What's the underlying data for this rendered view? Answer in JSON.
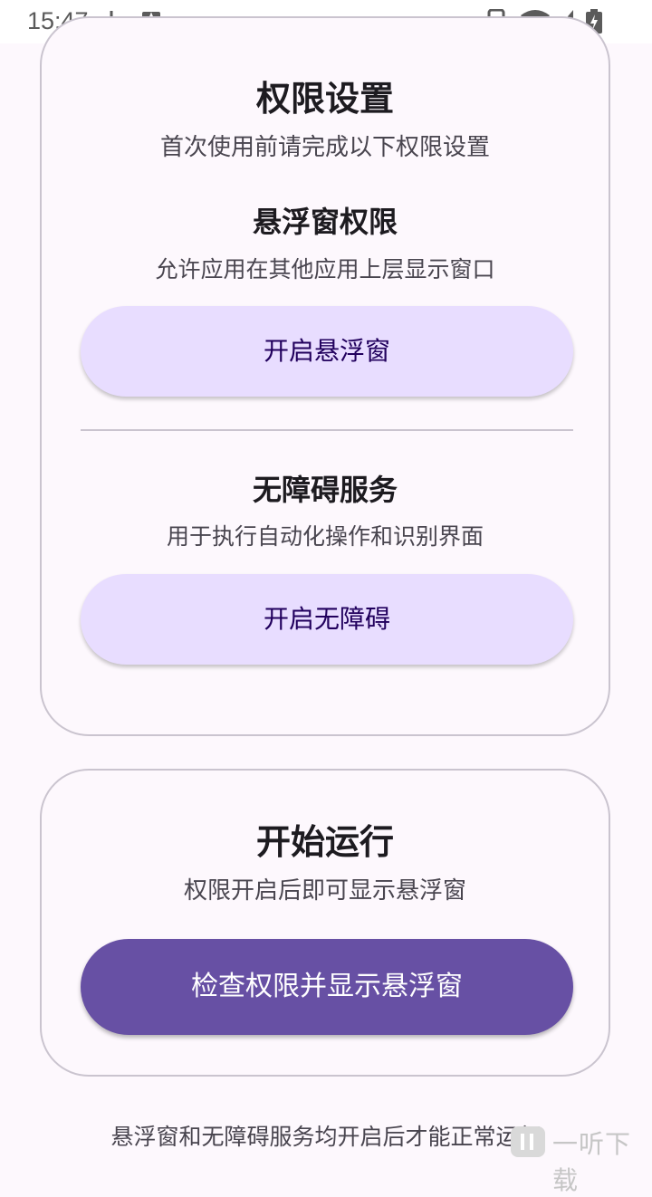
{
  "status_bar": {
    "time": "15:47"
  },
  "permission_card": {
    "title": "权限设置",
    "subtitle": "首次使用前请完成以下权限设置",
    "overlay": {
      "title": "悬浮窗权限",
      "description": "允许应用在其他应用上层显示窗口",
      "button_label": "开启悬浮窗"
    },
    "accessibility": {
      "title": "无障碍服务",
      "description": "用于执行自动化操作和识别界面",
      "button_label": "开启无障碍"
    }
  },
  "run_card": {
    "title": "开始运行",
    "subtitle": "权限开启后即可显示悬浮窗",
    "button_label": "检查权限并显示悬浮窗"
  },
  "footer_note": "悬浮窗和无障碍服务均开启后才能正常运行",
  "watermark": {
    "text": "一听下载"
  },
  "colors": {
    "primary": "#6750a4",
    "tonal_button": "#e8ddff",
    "tonal_text": "#21005d",
    "outline": "#cac4cf",
    "background": "#fdf8fd"
  }
}
